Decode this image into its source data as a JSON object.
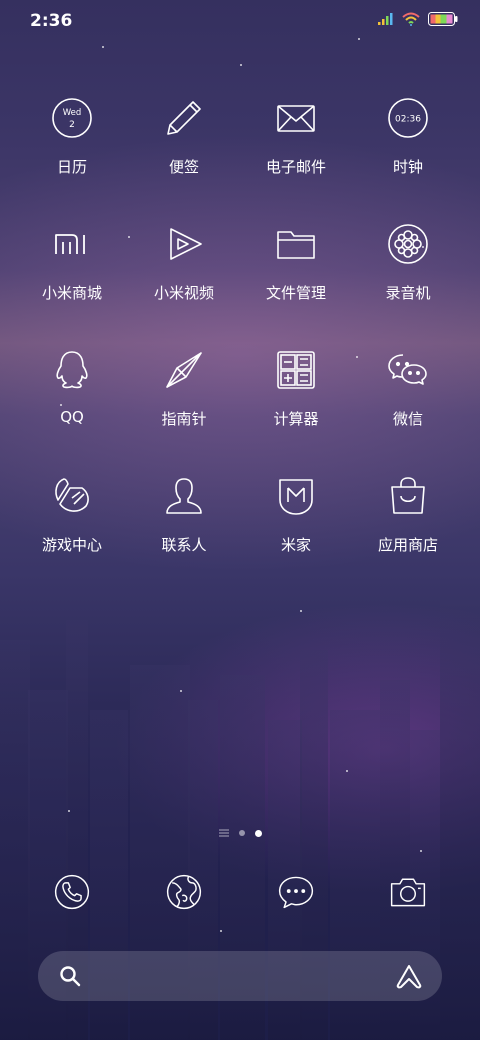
{
  "status_bar": {
    "time": "2:36",
    "icons": [
      "signal-icon",
      "wifi-icon",
      "battery-icon"
    ]
  },
  "apps": [
    {
      "label": "日历",
      "icon": "calendar-icon",
      "icon_text_top": "Wed",
      "icon_text_bottom": "2"
    },
    {
      "label": "便签",
      "icon": "pencil-icon"
    },
    {
      "label": "电子邮件",
      "icon": "mail-icon"
    },
    {
      "label": "时钟",
      "icon": "clock-icon",
      "icon_text": "02:36"
    },
    {
      "label": "小米商城",
      "icon": "mi-logo-icon"
    },
    {
      "label": "小米视频",
      "icon": "video-play-icon"
    },
    {
      "label": "文件管理",
      "icon": "folder-icon"
    },
    {
      "label": "录音机",
      "icon": "recorder-icon"
    },
    {
      "label": "QQ",
      "icon": "qq-penguin-icon"
    },
    {
      "label": "指南针",
      "icon": "compass-icon"
    },
    {
      "label": "计算器",
      "icon": "calculator-icon"
    },
    {
      "label": "微信",
      "icon": "wechat-icon"
    },
    {
      "label": "游戏中心",
      "icon": "game-center-icon"
    },
    {
      "label": "联系人",
      "icon": "contacts-icon"
    },
    {
      "label": "米家",
      "icon": "mijia-icon"
    },
    {
      "label": "应用商店",
      "icon": "app-store-icon"
    }
  ],
  "page_indicator": {
    "pages": 2,
    "active_index": 1
  },
  "dock": [
    {
      "icon": "phone-icon"
    },
    {
      "icon": "browser-icon"
    },
    {
      "icon": "messages-icon"
    },
    {
      "icon": "camera-icon"
    }
  ],
  "search_bar": {
    "left_icon": "search-icon",
    "right_icon": "assistant-icon"
  },
  "colors": {
    "icon_stroke": "#ffffff",
    "background_top": "#35305f",
    "background_bottom": "#1d1e48"
  }
}
